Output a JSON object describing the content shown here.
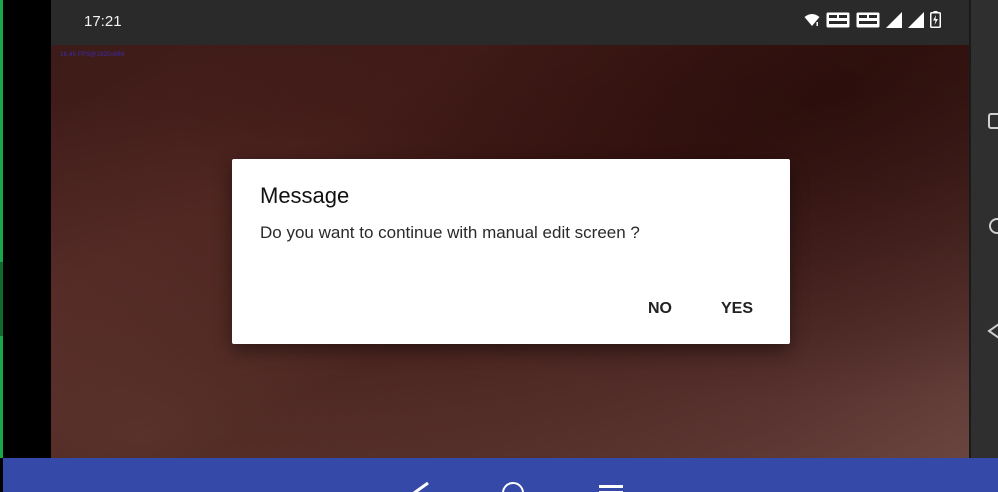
{
  "status_bar": {
    "time": "17:21",
    "icons": [
      "wifi-icon",
      "volte-wifi-icon",
      "volte-lte-icon",
      "signal-icon",
      "signal-icon",
      "battery-icon"
    ],
    "icon_texts": {
      "volte_wifi": "VoLTE WiFi2",
      "volte_lte": "VoLTE LTE1"
    }
  },
  "overlay": {
    "fps_text": "18.45 FPS@1920x984"
  },
  "dialog": {
    "title": "Message",
    "message": "Do you want to continue with manual edit screen ?",
    "no_label": "NO",
    "yes_label": "YES"
  },
  "host_nav": {
    "icons": [
      "back-icon",
      "home-icon",
      "menu-icon"
    ]
  },
  "side_panel": {
    "icons": [
      "square-icon",
      "circle-icon",
      "triangle-icon"
    ]
  },
  "colors": {
    "host_nav_bg": "#3449a8",
    "status_bar_bg": "#2a2a2a",
    "dialog_bg": "#ffffff",
    "green_edge": "#17a84a"
  }
}
